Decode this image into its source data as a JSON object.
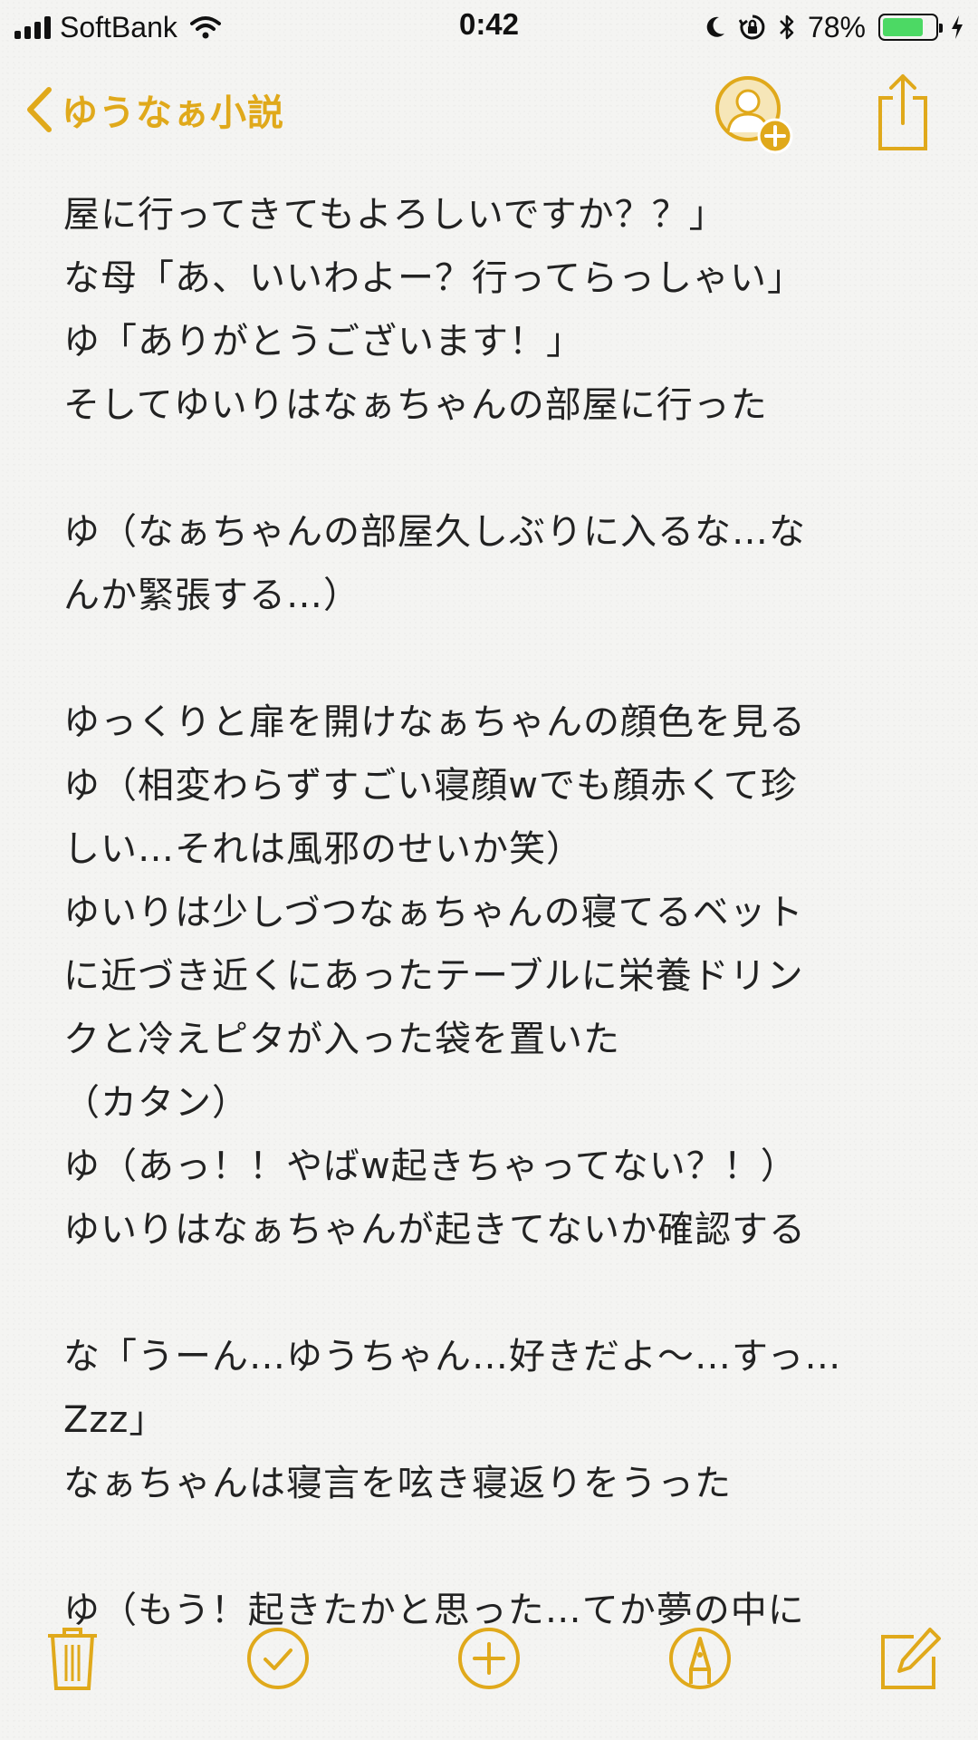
{
  "status_bar": {
    "carrier": "SoftBank",
    "time": "0:42",
    "battery_percent": "78%",
    "battery_level": 0.78
  },
  "nav": {
    "back_label": "ゆうなぁ小説"
  },
  "note": {
    "lines": [
      "屋に行ってきてもよろしいですか？？」",
      "な母「あ、いいわよー？行ってらっしゃい」",
      "ゆ「ありがとうございます！」",
      "そしてゆいりはなぁちゃんの部屋に行った",
      "",
      "ゆ（なぁちゃんの部屋久しぶりに入るな…な",
      "んか緊張する…）",
      "",
      "ゆっくりと扉を開けなぁちゃんの顔色を見る",
      "ゆ（相変わらずすごい寝顔wでも顔赤くて珍",
      "しい…それは風邪のせいか笑）",
      "ゆいりは少しづつなぁちゃんの寝てるベット",
      "に近づき近くにあったテーブルに栄養ドリン",
      "クと冷えピタが入った袋を置いた",
      "（カタン）",
      "ゆ（あっ！！やばw起きちゃってない？！）",
      "ゆいりはなぁちゃんが起きてないか確認する",
      "",
      "な「うーん…ゆうちゃん…好きだよ〜…すっ…",
      "Zzz」",
      "なぁちゃんは寝言を呟き寝返りをうった",
      "",
      "ゆ（もう！起きたかと思った…てか夢の中に"
    ]
  },
  "icons": {
    "accent_color": "#e0a91b",
    "battery_color": "#4cd964"
  }
}
